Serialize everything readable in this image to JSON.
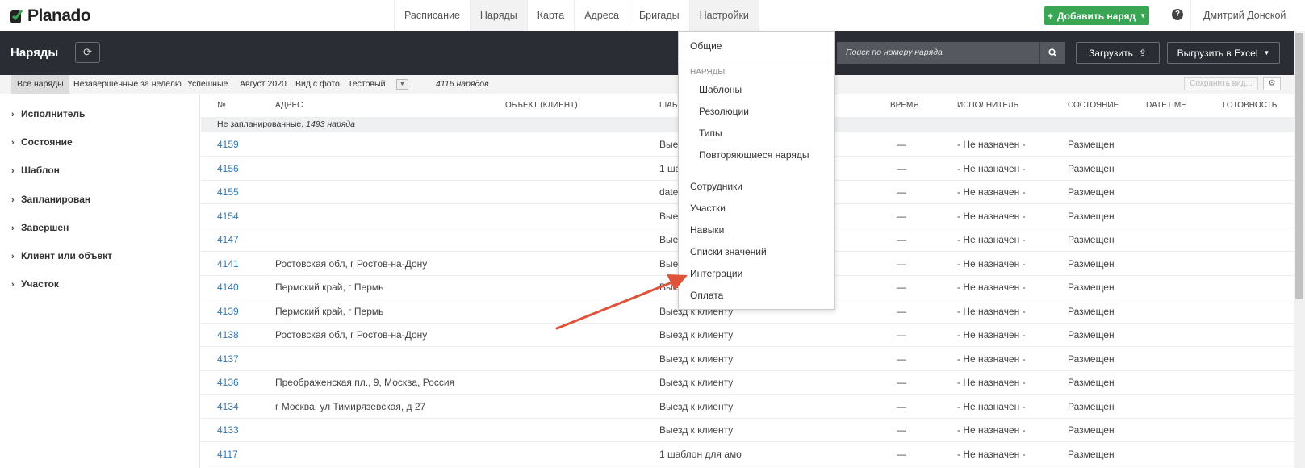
{
  "brand": {
    "name": "Planado"
  },
  "topnav": {
    "items": [
      "Расписание",
      "Наряды",
      "Карта",
      "Адреса",
      "Бригады",
      "Настройки"
    ],
    "add_button": "Добавить наряд",
    "user_name": "Дмитрий Донской"
  },
  "header": {
    "title": "Наряды",
    "search_placeholder": "Поиск по номеру наряда",
    "upload_button": "Загрузить",
    "export_button": "Выгрузить в Excel"
  },
  "filters": {
    "items": [
      "Все наряды",
      "Незавершенные за неделю",
      "Успешные",
      "Август 2020",
      "Вид с фото",
      "Тестовый"
    ],
    "count": "4116 нарядов",
    "save_view": "Сохранить вид..."
  },
  "sidebar": {
    "items": [
      "Исполнитель",
      "Состояние",
      "Шаблон",
      "Запланирован",
      "Завершен",
      "Клиент или объект",
      "Участок"
    ]
  },
  "table": {
    "columns": [
      "№",
      "Адрес",
      "Объект (клиент)",
      "Шаблон",
      "Время",
      "Исполнитель",
      "Состояние",
      "Datetime",
      "Готовность"
    ],
    "group": {
      "label": "Не запланированные,",
      "count": "1493 наряда"
    },
    "rows": [
      {
        "num": "4159",
        "address": "",
        "template": "Выезд к клиенту",
        "time": "—",
        "assignee": "- Не назначен -",
        "status": "Размещен"
      },
      {
        "num": "4156",
        "address": "",
        "template": "1 шаблон для амо",
        "time": "—",
        "assignee": "- Не назначен -",
        "status": "Размещен"
      },
      {
        "num": "4155",
        "address": "",
        "template": "datetime",
        "time": "—",
        "assignee": "- Не назначен -",
        "status": "Размещен"
      },
      {
        "num": "4154",
        "address": "",
        "template": "Выезд к клиенту",
        "time": "—",
        "assignee": "- Не назначен -",
        "status": "Размещен"
      },
      {
        "num": "4147",
        "address": "",
        "template": "Выезд к клиенту",
        "time": "—",
        "assignee": "- Не назначен -",
        "status": "Размещен"
      },
      {
        "num": "4141",
        "address": "Ростовская обл, г Ростов-на-Дону",
        "template": "Выезд к клиенту",
        "time": "—",
        "assignee": "- Не назначен -",
        "status": "Размещен"
      },
      {
        "num": "4140",
        "address": "Пермский край, г Пермь",
        "template": "Выезд к клиенту",
        "time": "—",
        "assignee": "- Не назначен -",
        "status": "Размещен"
      },
      {
        "num": "4139",
        "address": "Пермский край, г Пермь",
        "template": "Выезд к клиенту",
        "time": "—",
        "assignee": "- Не назначен -",
        "status": "Размещен"
      },
      {
        "num": "4138",
        "address": "Ростовская обл, г Ростов-на-Дону",
        "template": "Выезд к клиенту",
        "time": "—",
        "assignee": "- Не назначен -",
        "status": "Размещен"
      },
      {
        "num": "4137",
        "address": "",
        "template": "Выезд к клиенту",
        "time": "—",
        "assignee": "- Не назначен -",
        "status": "Размещен"
      },
      {
        "num": "4136",
        "address": "Преображенская пл., 9, Москва, Россия",
        "template": "Выезд к клиенту",
        "time": "—",
        "assignee": "- Не назначен -",
        "status": "Размещен"
      },
      {
        "num": "4134",
        "address": "г Москва, ул Тимирязевская, д 27",
        "template": "Выезд к клиенту",
        "time": "—",
        "assignee": "- Не назначен -",
        "status": "Размещен"
      },
      {
        "num": "4133",
        "address": "",
        "template": "Выезд к клиенту",
        "time": "—",
        "assignee": "- Не назначен -",
        "status": "Размещен"
      },
      {
        "num": "4117",
        "address": "",
        "template": "1 шаблон для амо",
        "time": "—",
        "assignee": "- Не назначен -",
        "status": "Размещен"
      }
    ]
  },
  "settings_menu": {
    "general": "Общие",
    "orders_header": "Наряды",
    "orders_items": [
      "Шаблоны",
      "Резолюции",
      "Типы",
      "Повторяющиеся наряды"
    ],
    "other_items": [
      "Сотрудники",
      "Участки",
      "Навыки",
      "Списки значений",
      "Интеграции",
      "Оплата"
    ]
  },
  "colors": {
    "accent_green": "#3aa552",
    "link_blue": "#2f7ab7",
    "dark_bar": "#2a2d33",
    "annotation_arrow": "#e0533b"
  }
}
